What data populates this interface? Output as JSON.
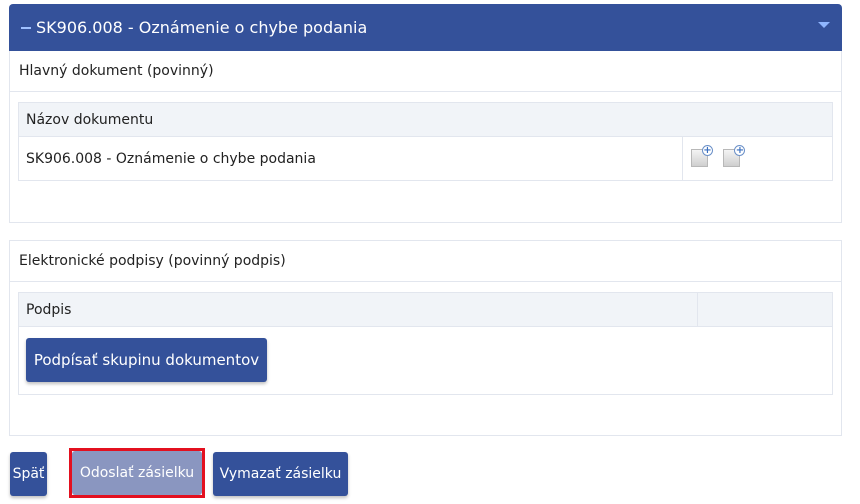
{
  "panel": {
    "title": "SK906.008 - Oznámenie o chybe podania"
  },
  "main_doc": {
    "section_title": "Hlavný dokument (povinný)",
    "column_header": "Názov dokumentu",
    "rows": [
      {
        "name": "SK906.008 - Oznámenie o chybe podania",
        "icons": [
          "add-document-icon",
          "add-document-icon"
        ]
      }
    ]
  },
  "signatures": {
    "section_title": "Elektronické podpisy (povinný podpis)",
    "column_header": "Podpis",
    "sign_button": "Podpísať skupinu dokumentov"
  },
  "actions": {
    "back": "Späť",
    "send": "Odoslať zásielku",
    "clear": "Vymazať zásielku"
  },
  "colors": {
    "primary": "#34519a",
    "disabled": "#8a96c0",
    "highlight": "#e3101f"
  }
}
